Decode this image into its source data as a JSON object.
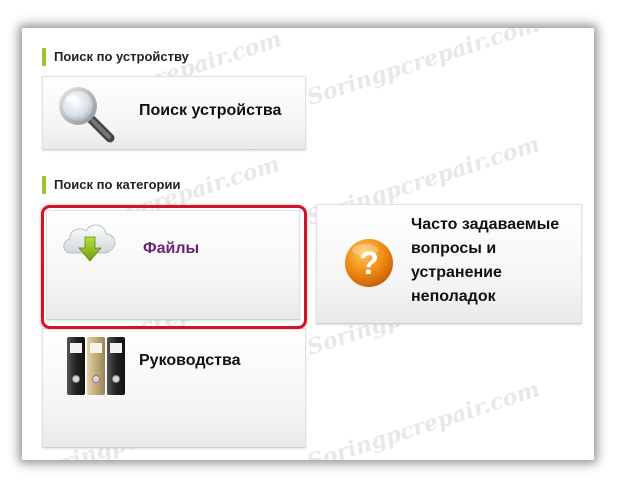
{
  "device_search": {
    "section_title": "Поиск по устройству",
    "card_label": "Поиск устройства",
    "icon": "magnifier-icon"
  },
  "category_search": {
    "section_title": "Поиск по категории",
    "files": {
      "label": "Файлы",
      "icon": "cloud-download-icon"
    },
    "faq": {
      "label_lines": [
        "Часто задаваемые",
        "вопросы и",
        "устранение",
        "неполадок"
      ],
      "icon": "question-icon"
    },
    "manuals": {
      "label": "Руководства",
      "icon": "binders-icon"
    }
  },
  "watermark_text": "Soringpcrepair.com",
  "colors": {
    "highlight": "#d0122a",
    "accent_label": "#6a2375",
    "section_marker": "#9bc32a",
    "question_orange": "#f08a12"
  }
}
